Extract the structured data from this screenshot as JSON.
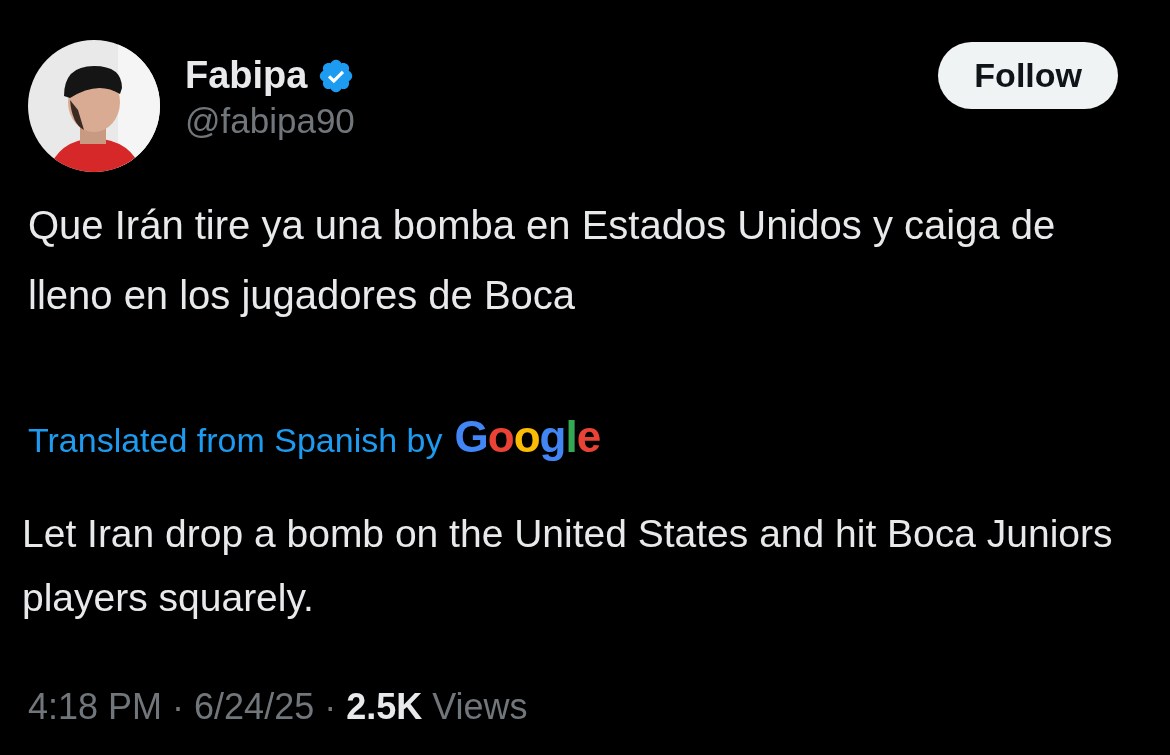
{
  "author": {
    "name": "Fabipa",
    "verified": true,
    "handle": "@fabipa90"
  },
  "follow_button": {
    "label": "Follow"
  },
  "tweet_text": "Que Irán tire ya una bomba en Estados Unidos y caiga de lleno en los jugadores de Boca",
  "translation": {
    "label": "Translated from Spanish by",
    "provider": "Google",
    "text": "Let Iran drop a bomb on the United States and hit Boca Juniors players squarely."
  },
  "meta": "4:18 PM · 6/24/25 · **2.5K** Views"
}
